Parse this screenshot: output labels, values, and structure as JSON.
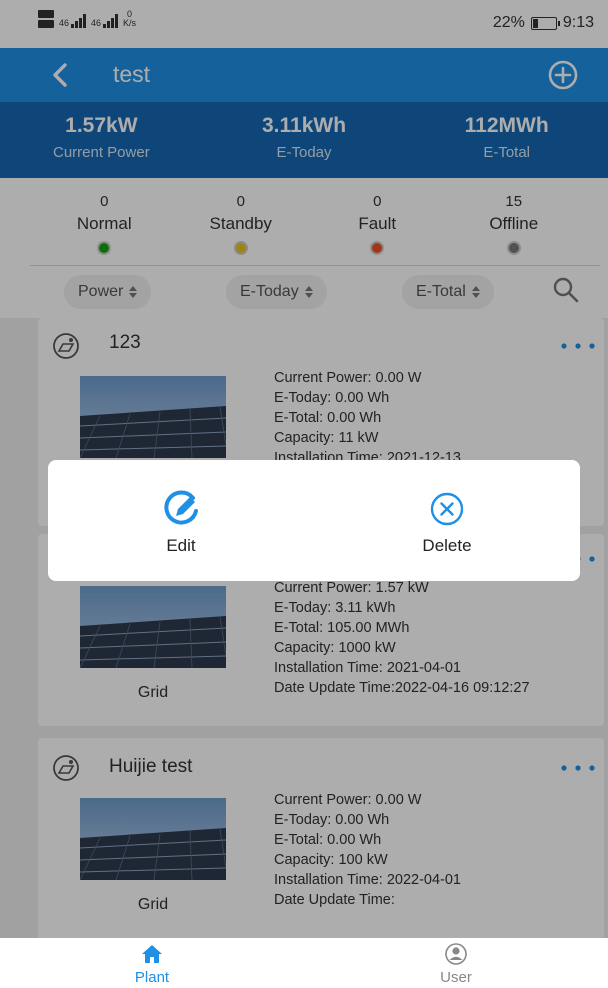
{
  "status_bar": {
    "network_speed": "0",
    "network_unit": "K/s",
    "signal_1": "46",
    "signal_2": "46",
    "battery": "22%",
    "battery_level": 0.22,
    "time": "9:13"
  },
  "header": {
    "title": "test",
    "back_icon": "chevron-left-icon",
    "add_icon": "plus-circle-icon",
    "color": "#1e90e6"
  },
  "summary": [
    {
      "value": "1.57kW",
      "label": "Current Power"
    },
    {
      "value": "3.11kWh",
      "label": "E-Today"
    },
    {
      "value": "112MWh",
      "label": "E-Total"
    }
  ],
  "summary_color": "#1568b3",
  "status_counts": [
    {
      "count": "0",
      "label": "Normal",
      "color": "#12a312"
    },
    {
      "count": "0",
      "label": "Standby",
      "color": "#e8c21c"
    },
    {
      "count": "0",
      "label": "Fault",
      "color": "#f05022"
    },
    {
      "count": "15",
      "label": "Offline",
      "color": "#7a7a7a"
    }
  ],
  "sort": {
    "power": "Power",
    "e_today": "E-Today",
    "e_total": "E-Total",
    "search_icon": "search-icon"
  },
  "plants": [
    {
      "name": "123",
      "type": "",
      "lines": [
        "Current Power: 0.00 W",
        "E-Today: 0.00 Wh",
        "E-Total: 0.00 Wh",
        "Capacity: 11 kW",
        "Installation Time: 2021-12-13"
      ]
    },
    {
      "name": "",
      "type": "Grid",
      "lines": [
        "Current Power: 1.57 kW",
        "E-Today: 3.11 kWh",
        "E-Total: 105.00 MWh",
        "Capacity: 1000 kW",
        "Installation Time: 2021-04-01",
        "Date Update Time:2022-04-16 09:12:27"
      ]
    },
    {
      "name": "Huijie test",
      "type": "Grid",
      "lines": [
        "Current Power: 0.00 W",
        "E-Today: 0.00 Wh",
        "E-Total: 0.00 Wh",
        "Capacity: 100 kW",
        "Installation Time: 2022-04-01",
        "Date Update Time:"
      ]
    }
  ],
  "dialog": {
    "edit": "Edit",
    "delete": "Delete",
    "accent": "#1e90e6"
  },
  "bottom_nav": {
    "plant": "Plant",
    "user": "User",
    "active_color": "#1e90e6",
    "inactive_color": "#888888"
  }
}
